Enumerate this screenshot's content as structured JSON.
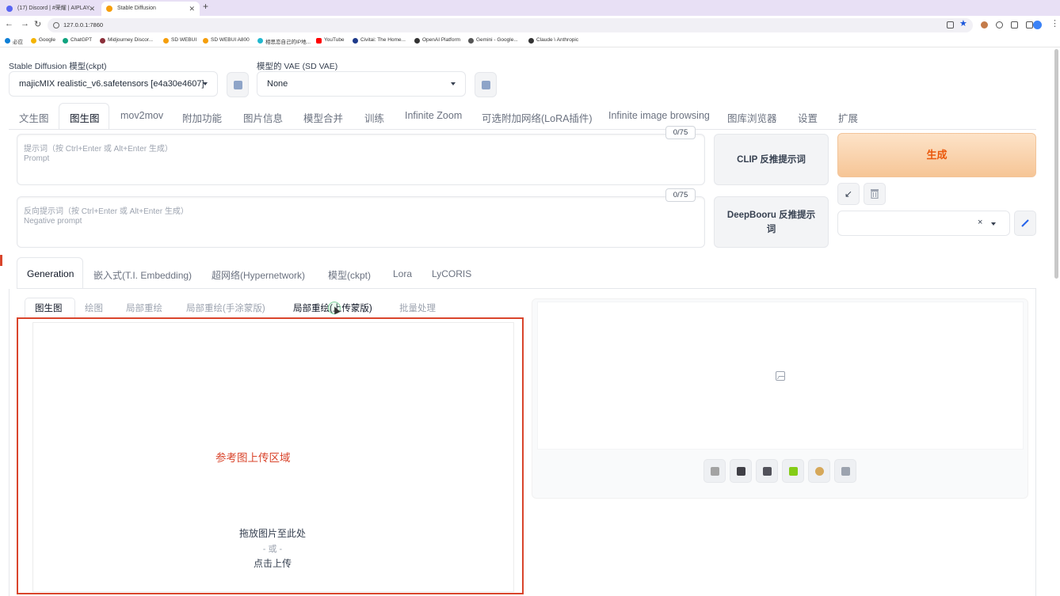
{
  "browser": {
    "tabs": [
      {
        "title": "(17) Discord | #荣耀 | AIPLAY..."
      },
      {
        "title": "Stable Diffusion"
      }
    ],
    "new_tab": "+",
    "address": "127.0.0.1:7860",
    "bookmarks": [
      "必应",
      "Google",
      "ChatGPT",
      "Midjourney Discor...",
      "SD WEBUI",
      "SD WEBUI A800",
      "相思恋自己的IP地...",
      "YouTube",
      "Civitai: The Home...",
      "OpenAI Platform",
      "Gemini - Google...",
      "Claude \\ Anthropic"
    ]
  },
  "models": {
    "ckpt_label": "Stable Diffusion 模型(ckpt)",
    "ckpt_value": "majicMIX realistic_v6.safetensors [e4a30e4607]",
    "vae_label": "模型的 VAE (SD VAE)",
    "vae_value": "None"
  },
  "main_tabs": [
    "文生图",
    "图生图",
    "mov2mov",
    "附加功能",
    "图片信息",
    "模型合并",
    "训练",
    "Infinite Zoom",
    "可选附加网络(LoRA插件)",
    "Infinite image browsing",
    "图库浏览器",
    "设置",
    "扩展"
  ],
  "prompt": {
    "placeholder_zh": "提示词（按 Ctrl+Enter 或 Alt+Enter 生成）",
    "placeholder_en": "Prompt",
    "counter": "0/75"
  },
  "negative_prompt": {
    "placeholder_zh": "反向提示词（按 Ctrl+Enter 或 Alt+Enter 生成）",
    "placeholder_en": "Negative prompt",
    "counter": "0/75"
  },
  "actions": {
    "clip": "CLIP 反推提示词",
    "deepbooru": "DeepBooru 反推提示词",
    "generate": "生成",
    "paste_icon": "↙",
    "trash_icon": "trash-icon",
    "clear_icon": "×",
    "edit_icon": "pencil-icon"
  },
  "sub_tabs": [
    "Generation",
    "嵌入式(T.I. Embedding)",
    "超网络(Hypernetwork)",
    "模型(ckpt)",
    "Lora",
    "LyCORIS"
  ],
  "mode_tabs": [
    "图生图",
    "绘图",
    "局部重绘",
    "局部重绘(手涂蒙版)",
    "局部重绘(上传蒙版)",
    "批量处理"
  ],
  "upload": {
    "annotation": "参考图上传区域",
    "drop": "拖放图片至此处",
    "or": "- 或 -",
    "click": "点击上传"
  },
  "colors": {
    "accent_orange": "#ea580c",
    "annotation_red": "#d9452c"
  }
}
